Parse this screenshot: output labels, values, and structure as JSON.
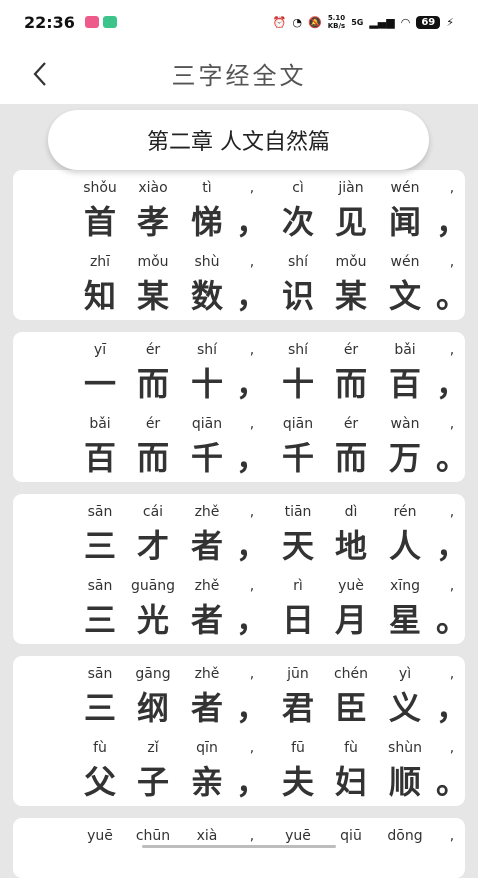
{
  "status_bar": {
    "time": "22:36",
    "net_speed": "5.10\nKB/s",
    "signal_label": "5G",
    "battery": "69"
  },
  "header": {
    "title": "三字经全文",
    "back_icon": "chevron-left-icon"
  },
  "chapter": {
    "title": "第二章  人文自然篇"
  },
  "verses": [
    {
      "lines": [
        {
          "pinyin": [
            "shǒu",
            "xiào",
            "tì",
            ",",
            "cì",
            "jiàn",
            "wén",
            ","
          ],
          "hanzi": [
            "首",
            "孝",
            "悌",
            "，",
            "次",
            "见",
            "闻",
            "，"
          ]
        },
        {
          "pinyin": [
            "zhī",
            "mǒu",
            "shù",
            ",",
            "shí",
            "mǒu",
            "wén",
            ","
          ],
          "hanzi": [
            "知",
            "某",
            "数",
            "，",
            "识",
            "某",
            "文",
            "。"
          ]
        }
      ]
    },
    {
      "lines": [
        {
          "pinyin": [
            "yī",
            "ér",
            "shí",
            ",",
            "shí",
            "ér",
            "bǎi",
            ","
          ],
          "hanzi": [
            "一",
            "而",
            "十",
            "，",
            "十",
            "而",
            "百",
            "，"
          ]
        },
        {
          "pinyin": [
            "bǎi",
            "ér",
            "qiān",
            ",",
            "qiān",
            "ér",
            "wàn",
            ","
          ],
          "hanzi": [
            "百",
            "而",
            "千",
            "，",
            "千",
            "而",
            "万",
            "。"
          ]
        }
      ]
    },
    {
      "lines": [
        {
          "pinyin": [
            "sān",
            "cái",
            "zhě",
            ",",
            "tiān",
            "dì",
            "rén",
            ","
          ],
          "hanzi": [
            "三",
            "才",
            "者",
            "，",
            "天",
            "地",
            "人",
            "，"
          ]
        },
        {
          "pinyin": [
            "sān",
            "guāng",
            "zhě",
            ",",
            "rì",
            "yuè",
            "xīng",
            ","
          ],
          "hanzi": [
            "三",
            "光",
            "者",
            "，",
            "日",
            "月",
            "星",
            "。"
          ]
        }
      ]
    },
    {
      "lines": [
        {
          "pinyin": [
            "sān",
            "gāng",
            "zhě",
            ",",
            "jūn",
            "chén",
            "yì",
            ","
          ],
          "hanzi": [
            "三",
            "纲",
            "者",
            "，",
            "君",
            "臣",
            "义",
            "，"
          ]
        },
        {
          "pinyin": [
            "fù",
            "zǐ",
            "qīn",
            ",",
            "fū",
            "fù",
            "shùn",
            ","
          ],
          "hanzi": [
            "父",
            "子",
            "亲",
            "，",
            "夫",
            "妇",
            "顺",
            "。"
          ]
        }
      ]
    },
    {
      "lines": [
        {
          "pinyin": [
            "yuē",
            "chūn",
            "xià",
            ",",
            "yuē",
            "qiū",
            "dōng",
            ","
          ],
          "hanzi": [
            "",
            "",
            "",
            "",
            "",
            "",
            "",
            ""
          ]
        }
      ]
    }
  ],
  "colors": {
    "background": "#e6e6e6",
    "card": "#ffffff",
    "text": "#333333"
  }
}
